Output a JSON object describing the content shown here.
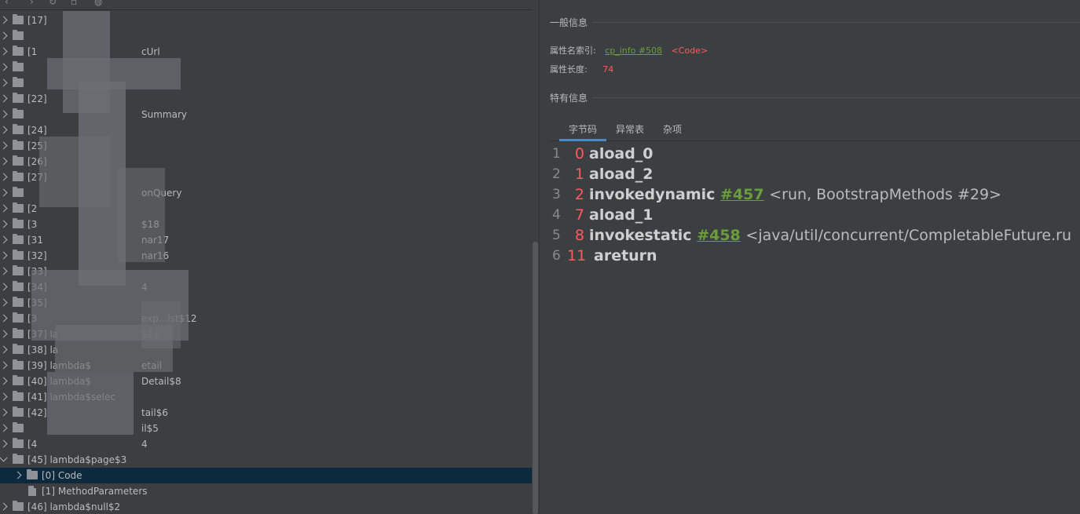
{
  "tree": {
    "rows": [
      {
        "label": "[17]",
        "kind": "folder",
        "expanded": false,
        "indent": 0
      },
      {
        "label": "",
        "kind": "folder",
        "expanded": false,
        "indent": 0
      },
      {
        "label": "[1",
        "suffix": "cUrl",
        "kind": "folder",
        "expanded": false,
        "indent": 0
      },
      {
        "label": "",
        "kind": "folder",
        "expanded": false,
        "indent": 0
      },
      {
        "label": "",
        "kind": "folder",
        "expanded": false,
        "indent": 0
      },
      {
        "label": "[22]",
        "kind": "folder",
        "expanded": false,
        "indent": 0
      },
      {
        "label": "",
        "suffix": "Summary",
        "kind": "folder",
        "expanded": false,
        "indent": 0
      },
      {
        "label": "[24]",
        "kind": "folder",
        "expanded": false,
        "indent": 0
      },
      {
        "label": "[25]",
        "kind": "folder",
        "expanded": false,
        "indent": 0
      },
      {
        "label": "[26]",
        "kind": "folder",
        "expanded": false,
        "indent": 0
      },
      {
        "label": "[27]",
        "kind": "folder",
        "expanded": false,
        "indent": 0
      },
      {
        "label": "",
        "suffix": "onQuery",
        "kind": "folder",
        "expanded": false,
        "indent": 0
      },
      {
        "label": "[2",
        "kind": "folder",
        "expanded": false,
        "indent": 0
      },
      {
        "label": "[3",
        "suffix": "$18",
        "kind": "folder",
        "expanded": false,
        "indent": 0
      },
      {
        "label": "[31",
        "suffix": "nar17",
        "kind": "folder",
        "expanded": false,
        "indent": 0
      },
      {
        "label": "[32]",
        "suffix": "nar16",
        "kind": "folder",
        "expanded": false,
        "indent": 0
      },
      {
        "label": "[33]",
        "kind": "folder",
        "expanded": false,
        "indent": 0
      },
      {
        "label": "[34]",
        "suffix": "4",
        "kind": "folder",
        "expanded": false,
        "indent": 0
      },
      {
        "label": "[35]",
        "kind": "folder",
        "expanded": false,
        "indent": 0
      },
      {
        "label": "[3",
        "suffix": "exp...ist$12",
        "kind": "folder",
        "expanded": false,
        "indent": 0
      },
      {
        "label": "[37] la",
        "suffix": "$11",
        "kind": "folder",
        "expanded": false,
        "indent": 0
      },
      {
        "label": "[38] la",
        "kind": "folder",
        "expanded": false,
        "indent": 0
      },
      {
        "label": "[39] lambda$",
        "suffix": "etail",
        "kind": "folder",
        "expanded": false,
        "indent": 0
      },
      {
        "label": "[40] lambda$",
        "suffix": "Detail$8",
        "kind": "folder",
        "expanded": false,
        "indent": 0
      },
      {
        "label": "[41] lambda$selec",
        "kind": "folder",
        "expanded": false,
        "indent": 0
      },
      {
        "label": "[42]",
        "suffix": "tail$6",
        "kind": "folder",
        "expanded": false,
        "indent": 0
      },
      {
        "label": "",
        "suffix": "il$5",
        "kind": "folder",
        "expanded": false,
        "indent": 0
      },
      {
        "label": "[4",
        "suffix": "4",
        "kind": "folder",
        "expanded": false,
        "indent": 0
      },
      {
        "label": "[45] lambda$page$3",
        "kind": "folder",
        "expanded": true,
        "indent": 0
      },
      {
        "label": "[0] Code",
        "kind": "folder",
        "expanded": false,
        "indent": 1,
        "selected": true
      },
      {
        "label": "[1] MethodParameters",
        "kind": "file",
        "indent": 1
      },
      {
        "label": "[46] lambda$null$2",
        "kind": "folder",
        "expanded": false,
        "indent": 0
      }
    ]
  },
  "info": {
    "general_title": "一般信息",
    "name_index_label": "属性名索引:",
    "name_index_link": "cp_info #508",
    "name_index_value": "<Code>",
    "length_label": "属性长度:",
    "length_value": "74",
    "specific_title": "特有信息"
  },
  "tabs": [
    {
      "label": "字节码",
      "active": true
    },
    {
      "label": "异常表",
      "active": false
    },
    {
      "label": "杂项",
      "active": false
    }
  ],
  "bytecode": [
    {
      "line": "1",
      "offset": "0",
      "op": "aload_0",
      "ref": "",
      "comment": ""
    },
    {
      "line": "2",
      "offset": "1",
      "op": "aload_2",
      "ref": "",
      "comment": ""
    },
    {
      "line": "3",
      "offset": "2",
      "op": "invokedynamic",
      "ref": "#457",
      "comment": "<run, BootstrapMethods #29>"
    },
    {
      "line": "4",
      "offset": "7",
      "op": "aload_1",
      "ref": "",
      "comment": ""
    },
    {
      "line": "5",
      "offset": "8",
      "op": "invokestatic",
      "ref": "#458",
      "comment": "<java/util/concurrent/CompletableFuture.ru"
    },
    {
      "line": "6",
      "offset": "11",
      "op": "areturn",
      "ref": "",
      "comment": ""
    }
  ],
  "colors": {
    "background": "#3c3f41",
    "selection": "#0d293e",
    "offset": "#ff5a5a",
    "reference": "#6a9e3a",
    "tab_underline": "#4a88c7"
  }
}
